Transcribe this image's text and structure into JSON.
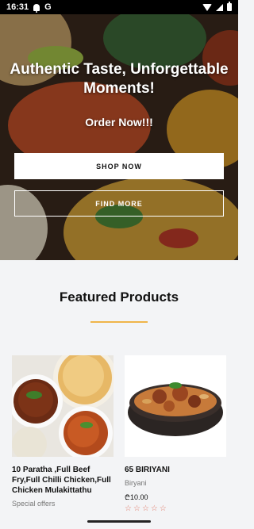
{
  "status_bar": {
    "time": "16:31",
    "left_icons": [
      "bell-icon",
      "google-icon"
    ],
    "google_glyph": "G",
    "right_icons": [
      "wifi-icon",
      "signal-icon",
      "battery-icon"
    ]
  },
  "hero": {
    "title": "Authentic Taste, Unforgettable Moments!",
    "subtitle": "Order Now!!!",
    "shop_button": "SHOP NOW",
    "find_button": "FIND MORE"
  },
  "featured": {
    "title": "Featured Products",
    "divider_color": "#f0b54a"
  },
  "products": [
    {
      "name": "10 Paratha ,Full Beef Fry,Full Chilli Chicken,Full Chicken Mulakittathu",
      "category": "Special offers",
      "price": "",
      "rating": null
    },
    {
      "name": "65 BIRIYANI",
      "category": "Biryani",
      "price": "₾10.00",
      "rating": 0,
      "rating_max": 5
    }
  ],
  "colors": {
    "accent": "#f0b54a",
    "star": "#e07b6a"
  }
}
